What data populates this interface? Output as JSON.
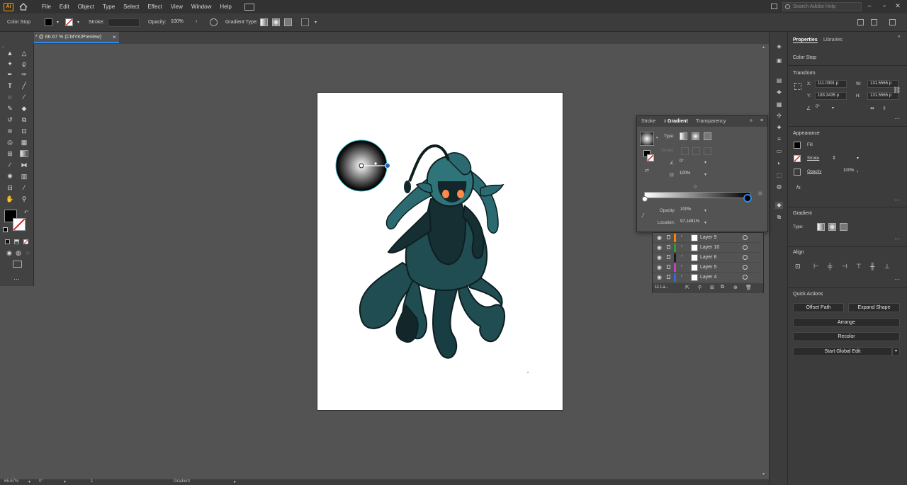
{
  "menubar": {
    "logo": "Ai",
    "items": [
      "File",
      "Edit",
      "Object",
      "Type",
      "Select",
      "Effect",
      "View",
      "Window",
      "Help"
    ],
    "search_placeholder": "Search Adobe Help"
  },
  "controlbar": {
    "context": "Color Stop",
    "stroke_label": "Stroke:",
    "opacity_label": "Opacity:",
    "opacity_value": "100%",
    "gradient_type_label": "Gradient Type:"
  },
  "document": {
    "tab_title": "* @ 66.67 % (CMYK/Preview)",
    "close": "×"
  },
  "statusbar": {
    "zoom": "66.67%",
    "rotation": "0°",
    "artboard": "1",
    "tool": "Gradient"
  },
  "properties": {
    "tabs": [
      "Properties",
      "Libraries"
    ],
    "context": "Color Stop",
    "transform": {
      "title": "Transform",
      "x_label": "X:",
      "x_value": "111.0391 p",
      "y_label": "Y:",
      "y_value": "183.3435 p",
      "w_label": "W:",
      "w_value": "131.5565 p",
      "h_label": "H:",
      "h_value": "131.5565 p",
      "angle_value": "0°"
    },
    "appearance": {
      "title": "Appearance",
      "fill_label": "Fill",
      "stroke_label": "Stroke",
      "opacity_label": "Opacity",
      "opacity_value": "100%",
      "fx": "fx."
    },
    "gradient": {
      "title": "Gradient",
      "type_label": "Type:"
    },
    "align": {
      "title": "Align"
    },
    "quick_actions": {
      "title": "Quick Actions",
      "offset_path": "Offset Path",
      "expand_shape": "Expand Shape",
      "arrange": "Arrange",
      "recolor": "Recolor",
      "start_global_edit": "Start Global Edit"
    }
  },
  "gradient_panel": {
    "tabs": [
      "Stroke",
      "Gradient",
      "Transparency"
    ],
    "type_label": "Type:",
    "stroke_label": "Stroke:",
    "angle_value": "0°",
    "aspect_value": "100%",
    "opacity_label": "Opacity:",
    "opacity_value": "100%",
    "location_label": "Location:",
    "location_value": "97.1491%"
  },
  "layers_panel": {
    "layers": [
      {
        "name": "Layer 9",
        "color": "#ff7f00"
      },
      {
        "name": "Layer 10",
        "color": "#2e9e2e"
      },
      {
        "name": "Layer 8",
        "color": "#1a1a1a"
      },
      {
        "name": "Layer 5",
        "color": "#c040c0"
      },
      {
        "name": "Layer 4",
        "color": "#2d6be0"
      }
    ],
    "count_label": "11 La..."
  },
  "colors": {
    "accent": "#2d8ceb",
    "creature": "#1f4d52",
    "creature_dark": "#13272b",
    "eyes": "#ff8a4a"
  }
}
